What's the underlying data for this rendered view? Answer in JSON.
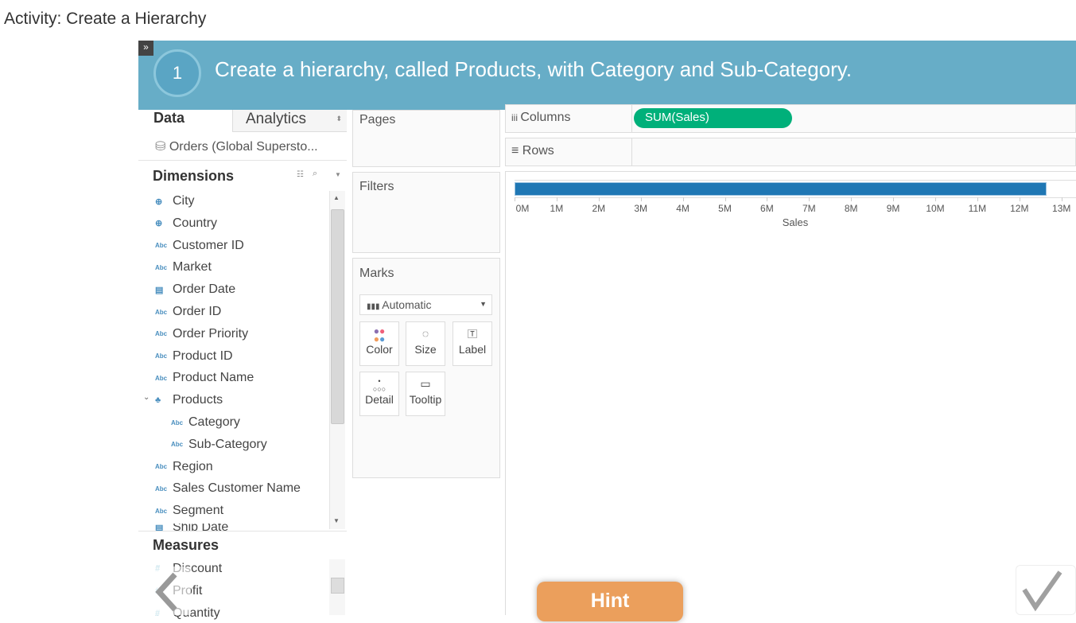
{
  "page_title": "Activity: Create a Hierarchy",
  "step": {
    "number": "1",
    "instruction": "Create a hierarchy, called Products, with Category and Sub-Category."
  },
  "data_pane": {
    "tab_data": "Data",
    "tab_analytics": "Analytics",
    "source": "Orders (Global Supersto...",
    "dimensions_header": "Dimensions",
    "measures_header": "Measures",
    "dimensions": [
      {
        "label": "City",
        "icon": "globe-icon"
      },
      {
        "label": "Country",
        "icon": "globe-icon"
      },
      {
        "label": "Customer ID",
        "icon": "abc-icon"
      },
      {
        "label": "Market",
        "icon": "abc-icon"
      },
      {
        "label": "Order Date",
        "icon": "calendar-icon"
      },
      {
        "label": "Order ID",
        "icon": "abc-icon"
      },
      {
        "label": "Order Priority",
        "icon": "abc-icon"
      },
      {
        "label": "Product ID",
        "icon": "abc-icon"
      },
      {
        "label": "Product Name",
        "icon": "abc-icon"
      },
      {
        "label": "Products",
        "icon": "hierarchy-icon"
      },
      {
        "label": "Category",
        "icon": "abc-icon"
      },
      {
        "label": "Sub-Category",
        "icon": "abc-icon"
      },
      {
        "label": "Region",
        "icon": "abc-icon"
      },
      {
        "label": "Sales Customer Name",
        "icon": "abc-icon"
      },
      {
        "label": "Segment",
        "icon": "abc-icon"
      },
      {
        "label": "Ship Date",
        "icon": "calendar-icon"
      }
    ],
    "measures": [
      "Discount",
      "Profit",
      "Quantity"
    ]
  },
  "cards": {
    "pages": "Pages",
    "filters": "Filters",
    "marks": "Marks",
    "mark_type": "Automatic",
    "buttons": [
      "Color",
      "Size",
      "Label",
      "Detail",
      "Tooltip"
    ]
  },
  "shelves": {
    "columns": "Columns",
    "rows": "Rows",
    "columns_pill": "SUM(Sales)",
    "pill_color": "#00b07a"
  },
  "chart_data": {
    "type": "bar",
    "categories": [
      ""
    ],
    "values": [
      12.64
    ],
    "xlabel": "Sales",
    "ticks": [
      "0M",
      "1M",
      "2M",
      "3M",
      "4M",
      "5M",
      "6M",
      "7M",
      "8M",
      "9M",
      "10M",
      "11M",
      "12M",
      "13M"
    ],
    "xlim": [
      0,
      13
    ],
    "unit": "M",
    "bar_color": "#1f77b4"
  },
  "hint_label": "Hint"
}
